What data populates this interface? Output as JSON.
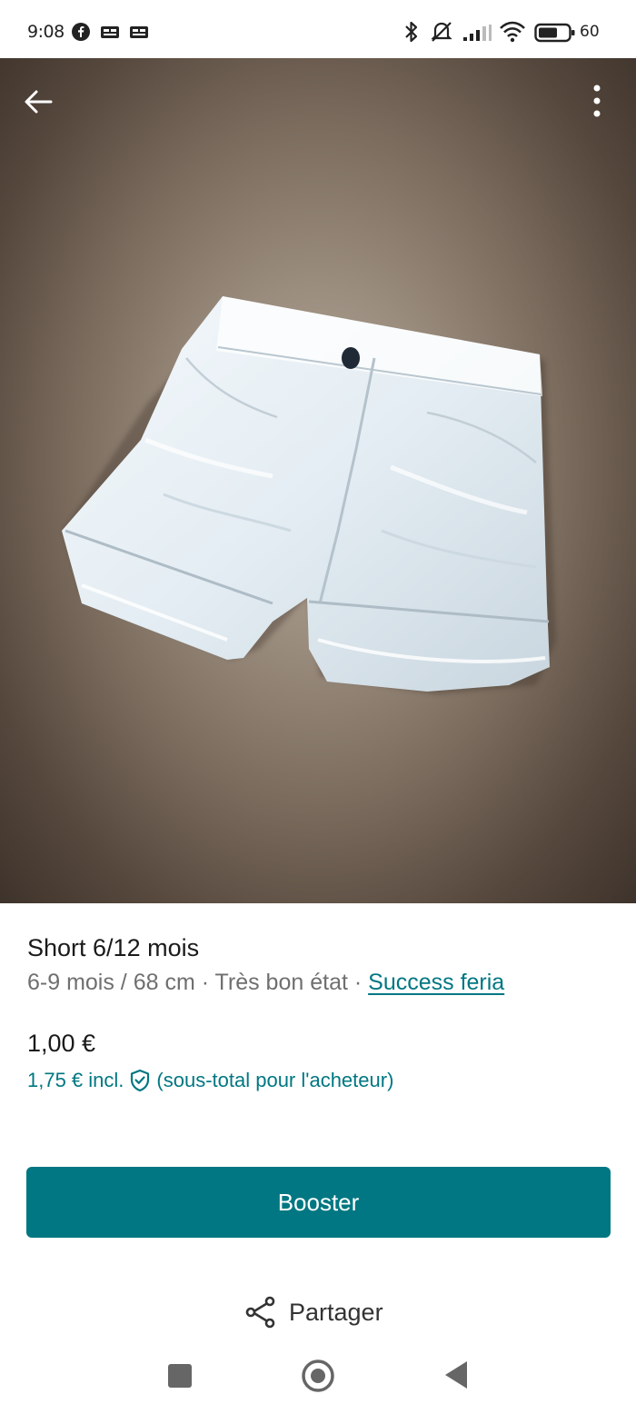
{
  "status_bar": {
    "time": "9:08",
    "battery": "60"
  },
  "toolbar": {
    "back_icon": "arrow-left-icon",
    "menu_icon": "more-vertical-icon"
  },
  "listing": {
    "title": "Short 6/12 mois",
    "meta_prefix": "6-9 mois / 68 cm · Très bon état · ",
    "brand": "Success feria",
    "price": "1,00 €",
    "price_incl": "1,75 €  incl.",
    "price_incl_note": "(sous-total pour l'acheteur)"
  },
  "actions": {
    "booster_label": "Booster",
    "share_label": "Partager"
  },
  "colors": {
    "accent": "#007782"
  }
}
